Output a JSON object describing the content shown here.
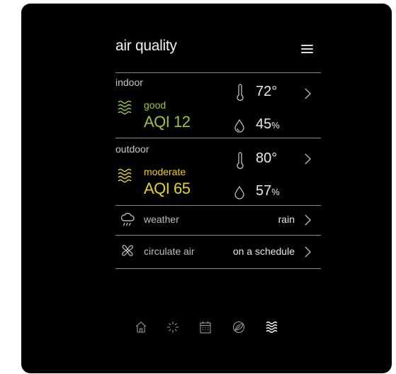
{
  "header": {
    "title": "air quality",
    "menu_icon": "hamburger-menu-icon"
  },
  "indoor": {
    "label": "indoor",
    "status": "good",
    "aqi": "AQI 12",
    "temperature": "72°",
    "humidity_value": "45",
    "humidity_unit": "%",
    "status_color": "#9ac73a"
  },
  "outdoor": {
    "label": "outdoor",
    "status": "moderate",
    "aqi": "AQI 65",
    "temperature": "80°",
    "humidity_value": "57",
    "humidity_unit": "%",
    "status_color": "#e6d221"
  },
  "weather": {
    "label": "weather",
    "value": "rain"
  },
  "circulate": {
    "label": "circulate air",
    "value": "on a schedule"
  },
  "bottom_nav": [
    {
      "name": "home",
      "icon": "home-icon"
    },
    {
      "name": "brightness",
      "icon": "sparkle-icon"
    },
    {
      "name": "calendar",
      "icon": "calendar-icon"
    },
    {
      "name": "leaf",
      "icon": "leaf-icon"
    },
    {
      "name": "air-quality",
      "icon": "air-waves-icon",
      "active": true
    }
  ]
}
